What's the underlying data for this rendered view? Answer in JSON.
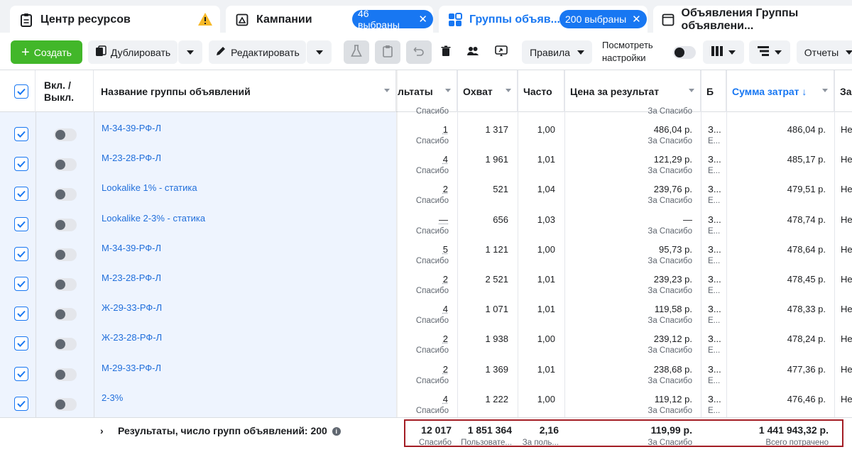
{
  "tabs": {
    "resources": {
      "label": "Центр ресурсов"
    },
    "campaigns": {
      "label": "Кампании",
      "selected": "46 выбраны"
    },
    "adsets": {
      "label": "Группы объяв...",
      "selected": "200 выбраны"
    },
    "ads": {
      "label": "Объявления Группы объявлени..."
    }
  },
  "toolbar": {
    "create": "Создать",
    "duplicate": "Дублировать",
    "edit": "Редактировать",
    "rules": "Правила",
    "view_settings_line1": "Посмотреть",
    "view_settings_line2": "настройки",
    "reports": "Отчеты"
  },
  "columns": {
    "onoff_line1": "Вкл. /",
    "onoff_line2": "Выкл.",
    "name": "Название группы объявлений",
    "results": "льтаты",
    "reach": "Охват",
    "frequency": "Часто",
    "cost_per_result": "Цена за результат",
    "budget": "Б",
    "amount_spent": "Сумма затрат ↓",
    "ends": "За"
  },
  "top_partial_sub": {
    "results": "Спасибо",
    "cost": "За Спасибо"
  },
  "rows": [
    {
      "name": "М-34-39-РФ-Л",
      "results": "1",
      "results_sub": "Спасибо",
      "reach": "1 317",
      "freq": "1,00",
      "cost": "486,04 р.",
      "cost_sub": "За Спасибо",
      "budget": "З...",
      "budget_sub": "Е...",
      "spent": "486,04 р.",
      "ends": "Не"
    },
    {
      "name": "М-23-28-РФ-Л",
      "results": "4",
      "results_sub": "Спасибо",
      "reach": "1 961",
      "freq": "1,01",
      "cost": "121,29 р.",
      "cost_sub": "За Спасибо",
      "budget": "З...",
      "budget_sub": "Е...",
      "spent": "485,17 р.",
      "ends": "Не"
    },
    {
      "name": "Lookalike 1% - статика",
      "results": "2",
      "results_sub": "Спасибо",
      "reach": "521",
      "freq": "1,04",
      "cost": "239,76 р.",
      "cost_sub": "За Спасибо",
      "budget": "З...",
      "budget_sub": "Е...",
      "spent": "479,51 р.",
      "ends": "Не"
    },
    {
      "name": "Lookalike 2-3% - статика",
      "results": "—",
      "results_sub": "Спасибо",
      "reach": "656",
      "freq": "1,03",
      "cost": "—",
      "cost_sub": "За Спасибо",
      "budget": "З...",
      "budget_sub": "Е...",
      "spent": "478,74 р.",
      "ends": "Не"
    },
    {
      "name": "М-34-39-РФ-Л",
      "results": "5",
      "results_sub": "Спасибо",
      "reach": "1 121",
      "freq": "1,00",
      "cost": "95,73 р.",
      "cost_sub": "За Спасибо",
      "budget": "З...",
      "budget_sub": "Е...",
      "spent": "478,64 р.",
      "ends": "Не"
    },
    {
      "name": "М-23-28-РФ-Л",
      "results": "2",
      "results_sub": "Спасибо",
      "reach": "2 521",
      "freq": "1,01",
      "cost": "239,23 р.",
      "cost_sub": "За Спасибо",
      "budget": "З...",
      "budget_sub": "Е...",
      "spent": "478,45 р.",
      "ends": "Не"
    },
    {
      "name": "Ж-29-33-РФ-Л",
      "results": "4",
      "results_sub": "Спасибо",
      "reach": "1 071",
      "freq": "1,01",
      "cost": "119,58 р.",
      "cost_sub": "За Спасибо",
      "budget": "З...",
      "budget_sub": "Е...",
      "spent": "478,33 р.",
      "ends": "Не"
    },
    {
      "name": "Ж-23-28-РФ-Л",
      "results": "2",
      "results_sub": "Спасибо",
      "reach": "1 938",
      "freq": "1,00",
      "cost": "239,12 р.",
      "cost_sub": "За Спасибо",
      "budget": "З...",
      "budget_sub": "Е...",
      "spent": "478,24 р.",
      "ends": "Не"
    },
    {
      "name": "М-29-33-РФ-Л",
      "results": "2",
      "results_sub": "Спасибо",
      "reach": "1 369",
      "freq": "1,01",
      "cost": "238,68 р.",
      "cost_sub": "За Спасибо",
      "budget": "З...",
      "budget_sub": "Е...",
      "spent": "477,36 р.",
      "ends": "Не"
    },
    {
      "name": "2-3%",
      "results": "4",
      "results_sub": "Спасибо",
      "reach": "1 222",
      "freq": "1,00",
      "cost": "119,12 р.",
      "cost_sub": "За Спасибо",
      "budget": "З...",
      "budget_sub": "Е...",
      "spent": "476,46 р.",
      "ends": "Не"
    }
  ],
  "footer": {
    "title": "Результаты, число групп объявлений: 200",
    "results": "12 017",
    "results_sub": "Спасибо",
    "reach": "1 851 364",
    "reach_sub": "Пользовате...",
    "freq": "2,16",
    "freq_sub": "За поль...",
    "cost": "119,99 р.",
    "cost_sub": "За Спасибо",
    "spent": "1 441 943,32 р.",
    "spent_sub": "Всего потрачено"
  },
  "colors": {
    "accent": "#1877f2",
    "create_green": "#42b72a",
    "link": "#216fdb",
    "highlight_border": "#a31d24",
    "warning": "#f7b928"
  }
}
